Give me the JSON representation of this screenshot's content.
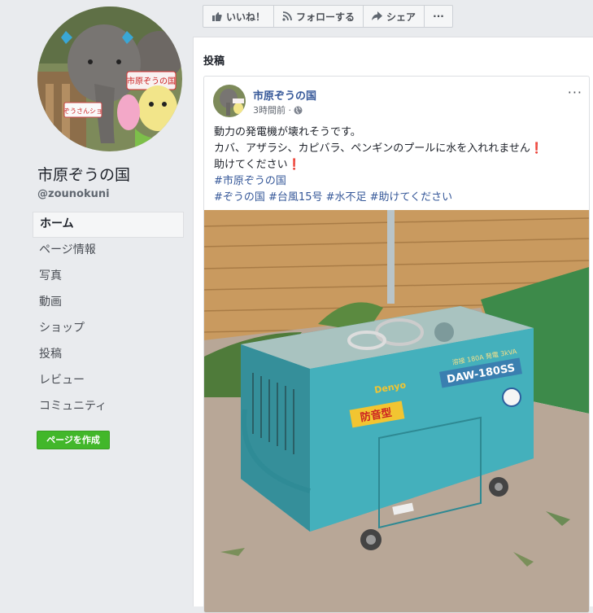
{
  "sidebar": {
    "page_name": "市原ぞうの国",
    "handle": "@zounokuni",
    "nav": [
      {
        "label": "ホーム",
        "active": true
      },
      {
        "label": "ページ情報"
      },
      {
        "label": "写真"
      },
      {
        "label": "動画"
      },
      {
        "label": "ショップ"
      },
      {
        "label": "投稿"
      },
      {
        "label": "レビュー"
      },
      {
        "label": "コミュニティ"
      }
    ],
    "create_page_label": "ページを作成",
    "avatar_sign_1": "市原ぞうの国",
    "avatar_sign_2": "ぞうさんショ"
  },
  "actions": {
    "like_label": "いいね！",
    "follow_label": "フォローする",
    "share_label": "シェア",
    "more_label": "···"
  },
  "posts_section": {
    "title": "投稿"
  },
  "post": {
    "author": "市原ぞうの国",
    "time": "3時間前 ·",
    "more": "···",
    "lines": {
      "l1": "動力の発電機が壊れそうです。",
      "l2": "カバ、アザラシ、カピバラ、ペンギンのプールに水を入れれません",
      "l2_mark": "❗",
      "l3": "助けてください",
      "l3_mark": "❗",
      "l4": "#市原ぞうの国",
      "l5": "#ぞうの国 #台風15号 #水不足 #助けてください"
    },
    "photo": {
      "brand": "Denyo",
      "model": "DAW-180SS",
      "label": "防音型",
      "sticker": "溶接 180A 発電 3kVA"
    }
  },
  "colors": {
    "link": "#365899",
    "create_button": "#42b72a",
    "generator": "#3fa7b3",
    "background": "#e9ebee"
  }
}
